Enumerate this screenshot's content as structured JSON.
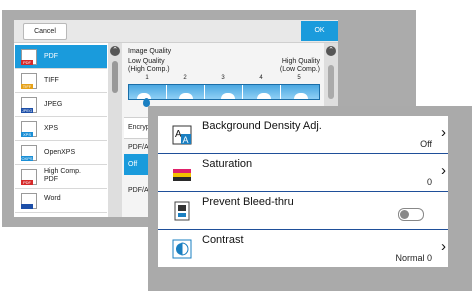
{
  "topbar": {
    "cancel_label": "Cancel",
    "ok_label": "OK"
  },
  "sidebar": {
    "items": [
      {
        "label": "PDF",
        "icon": "pdf-file-icon",
        "tag": "PDF"
      },
      {
        "label": "TIFF",
        "icon": "tiff-file-icon",
        "tag": "TIFF"
      },
      {
        "label": "JPEG",
        "icon": "jpeg-file-icon",
        "tag": "JPEG"
      },
      {
        "label": "XPS",
        "icon": "xps-file-icon",
        "tag": "XPS"
      },
      {
        "label": "OpenXPS",
        "icon": "oxps-file-icon",
        "tag": "OXPS"
      },
      {
        "label": "High Comp.",
        "label2": "PDF",
        "icon": "high-comp-pdf-icon",
        "tag": "PDF"
      },
      {
        "label": "Word",
        "icon": "word-file-icon",
        "tag": ""
      }
    ]
  },
  "image_quality": {
    "title": "Image Quality",
    "low_line1": "Low Quality",
    "low_line2": "(High Comp.)",
    "high_line1": "High Quality",
    "high_line2": "(Low Comp.)",
    "ticks": [
      "1",
      "2",
      "3",
      "4",
      "5"
    ],
    "selected_level": 1
  },
  "encrypt_label": "Encrypt",
  "pdfa_label": "PDF/A",
  "pdfa_off_label": "Off",
  "pdfa2_label": "PDF/A-",
  "settings": [
    {
      "title": "Background Density Adj.",
      "value": "Off",
      "icon": "background-density-icon",
      "control": "chevron"
    },
    {
      "title": "Saturation",
      "value": "0",
      "icon": "saturation-icon",
      "control": "chevron"
    },
    {
      "title": "Prevent Bleed-thru",
      "value": "",
      "icon": "prevent-bleed-thru-icon",
      "control": "toggle",
      "toggle_on": false
    },
    {
      "title": "Contrast",
      "value": "Normal 0",
      "icon": "contrast-icon",
      "control": "chevron"
    }
  ],
  "colors": {
    "accent": "#1a9bdc",
    "divider": "#1f4f99"
  }
}
